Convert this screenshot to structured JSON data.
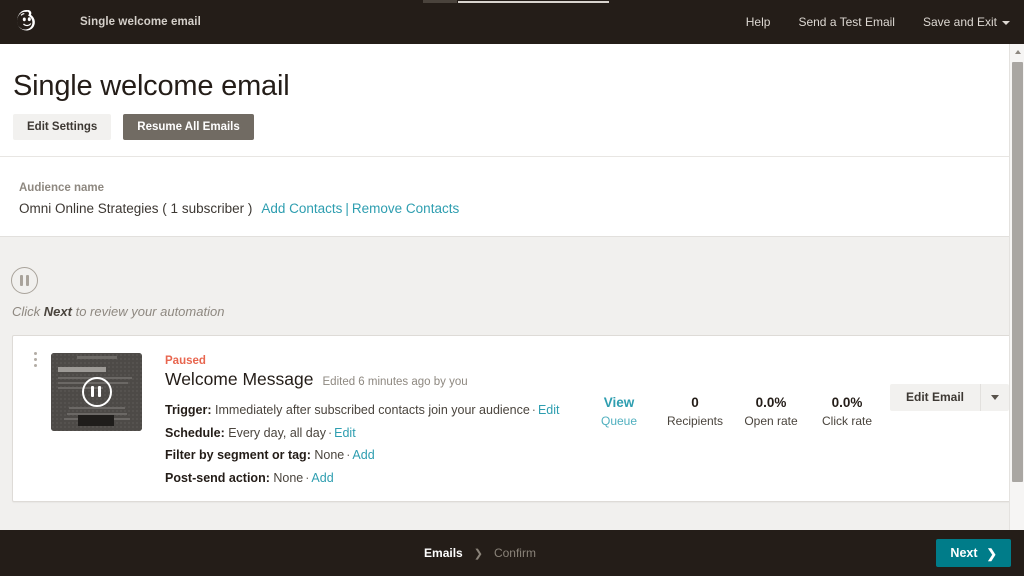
{
  "header": {
    "logo_icon": "mailchimp-freddie-logo",
    "title": "Single welcome email",
    "nav": [
      {
        "label": "Help",
        "icon": null
      },
      {
        "label": "Send a Test Email",
        "icon": null
      },
      {
        "label": "Save and Exit",
        "icon": "chevron-down-icon"
      }
    ]
  },
  "page": {
    "title": "Single welcome email",
    "buttons": {
      "edit_settings": "Edit Settings",
      "resume_all": "Resume All Emails"
    }
  },
  "audience": {
    "label": "Audience name",
    "name": "Omni Online Strategies ( 1 subscriber )",
    "add_contacts": "Add Contacts",
    "separator": "|",
    "remove_contacts": "Remove Contacts"
  },
  "workflow": {
    "status_icon": "pause-circle-icon",
    "hint_prefix": "Click ",
    "hint_bold": "Next",
    "hint_suffix": " to review your automation"
  },
  "email_card": {
    "menu_icon": "kebab-menu-icon",
    "thumbnail_icon": "pause-overlay-icon",
    "status": "Paused",
    "title": "Welcome Message",
    "edited": "Edited 6 minutes ago by you",
    "details": [
      {
        "label": "Trigger:",
        "value": "Immediately after subscribed contacts join your audience",
        "action": "Edit"
      },
      {
        "label": "Schedule:",
        "value": "Every day, all day",
        "action": "Edit"
      },
      {
        "label": "Filter by segment or tag:",
        "value": "None",
        "action": "Add"
      },
      {
        "label": "Post-send action:",
        "value": "None",
        "action": "Add"
      }
    ],
    "stats": [
      {
        "value": "View",
        "label": "Queue",
        "kind": "link"
      },
      {
        "value": "0",
        "label": "Recipients",
        "kind": "metric"
      },
      {
        "value": "0.0%",
        "label": "Open rate",
        "kind": "metric"
      },
      {
        "value": "0.0%",
        "label": "Click rate",
        "kind": "metric"
      }
    ],
    "edit_button": "Edit Email",
    "edit_button_caret_icon": "chevron-down-icon"
  },
  "footer": {
    "breadcrumb_current": "Emails",
    "breadcrumb_chevron": "❯",
    "breadcrumb_next": "Confirm",
    "next_button": "Next",
    "next_button_icon": "❯"
  },
  "colors": {
    "dark_bar": "#241d18",
    "teal_link": "#2e9eb0",
    "teal_button": "#007c89",
    "paused_status": "#e8664f",
    "gray_band": "#f1f0ee",
    "dark_button": "#716b63"
  }
}
